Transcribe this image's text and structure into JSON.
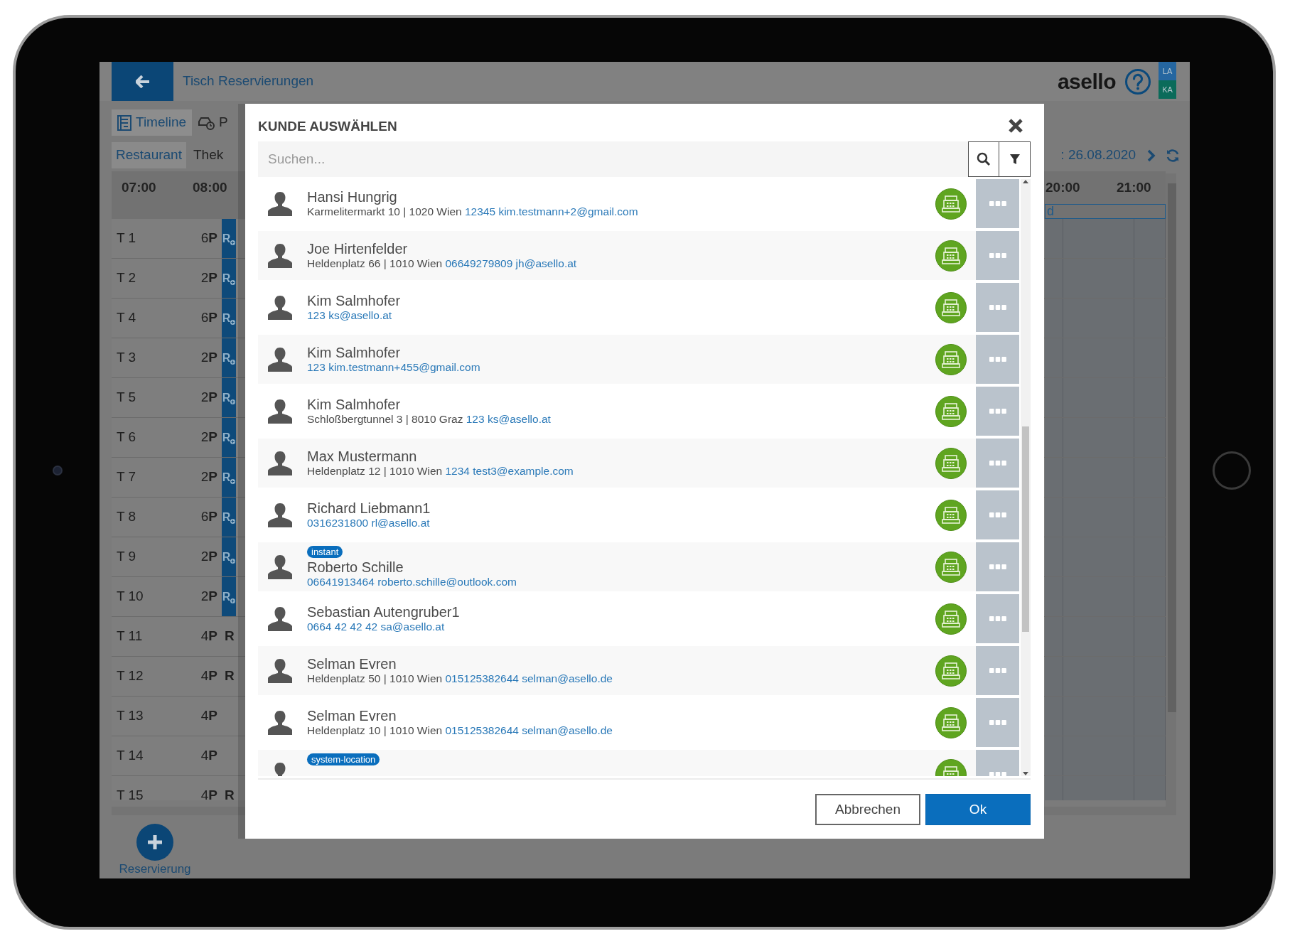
{
  "app": {
    "title": "Tisch Reservierungen",
    "brand": "asello",
    "users": [
      {
        "initials": "LA",
        "color": "#2566a0"
      },
      {
        "initials": "KA",
        "color": "#0b6b5a"
      }
    ]
  },
  "view_tabs": [
    {
      "label": "Timeline",
      "selected": true,
      "kind": "timeline"
    },
    {
      "label": "P",
      "selected": false,
      "kind": "car"
    }
  ],
  "areas": [
    {
      "label": "Restaurant",
      "selected": true
    },
    {
      "label": "Thek",
      "selected": false
    }
  ],
  "date": ": 26.08.2020",
  "time_columns": {
    "start": [
      "07:00",
      "08:00"
    ],
    "end": [
      "20:00",
      "21:00"
    ]
  },
  "reservation_bar": {
    "text": "d"
  },
  "tables": [
    {
      "name": "T 1",
      "seats": "6**P**",
      "marker": {
        "kind": "bar",
        "text": "R"
      }
    },
    {
      "name": "T 2",
      "seats": "2**P**",
      "marker": {
        "kind": "bar",
        "text": "R"
      }
    },
    {
      "name": "T 4",
      "seats": "6**P**",
      "marker": {
        "kind": "bar",
        "text": "R"
      }
    },
    {
      "name": "T 3",
      "seats": "2**P**",
      "marker": {
        "kind": "bar",
        "text": "R"
      }
    },
    {
      "name": "T 5",
      "seats": "2**P**",
      "marker": {
        "kind": "bar",
        "text": "R"
      }
    },
    {
      "name": "T 6",
      "seats": "2**P**",
      "marker": {
        "kind": "bar",
        "text": "R"
      }
    },
    {
      "name": "T 7",
      "seats": "2**P**",
      "marker": {
        "kind": "bar",
        "text": "R"
      }
    },
    {
      "name": "T 8",
      "seats": "6**P**",
      "marker": {
        "kind": "bar",
        "text": "R"
      }
    },
    {
      "name": "T 9",
      "seats": "2**P**",
      "marker": {
        "kind": "bar",
        "text": "R"
      }
    },
    {
      "name": "T 10",
      "seats": "2**P**",
      "marker": {
        "kind": "bar",
        "text": "R"
      }
    },
    {
      "name": "T 11",
      "seats": "4**P**",
      "marker": {
        "kind": "plain",
        "text": "R"
      }
    },
    {
      "name": "T 12",
      "seats": "4**P**",
      "marker": {
        "kind": "plain",
        "text": "R"
      }
    },
    {
      "name": "T 13",
      "seats": "4**P**"
    },
    {
      "name": "T 14",
      "seats": "4**P**"
    },
    {
      "name": "T 15",
      "seats": "4**P**",
      "marker": {
        "kind": "plain",
        "text": "R"
      }
    }
  ],
  "new_reservation": {
    "label": "Reservierung"
  },
  "dialog": {
    "title": "KUNDE AUSWÄHLEN",
    "search": {
      "placeholder": "Suchen..."
    },
    "customers": [
      {
        "name": "Hansi Hungrig",
        "address": "Karmelitermarkt 10 | 1020 Wien",
        "contact": "12345 kim.testmann+2@gmail.com"
      },
      {
        "name": "Joe Hirtenfelder",
        "address": "Heldenplatz 66 | 1010 Wien",
        "contact": "06649279809 jh@asello.at"
      },
      {
        "name": "Kim Salmhofer",
        "contact": "123 ks@asello.at"
      },
      {
        "name": "Kim Salmhofer",
        "contact": "123 kim.testmann+455@gmail.com"
      },
      {
        "name": "Kim Salmhofer",
        "address": "Schloßbergtunnel 3 | 8010 Graz",
        "contact": "123 ks@asello.at"
      },
      {
        "name": "Max Mustermann",
        "address": "Heldenplatz 12 | 1010 Wien",
        "contact": "1234 test3@example.com"
      },
      {
        "name": "Richard Liebmann1",
        "contact": "0316231800 rl@asello.at"
      },
      {
        "badge": "instant",
        "name": "Roberto Schille",
        "contact": "06641913464 roberto.schille@outlook.com"
      },
      {
        "name": "Sebastian Autengruber1",
        "contact": "0664 42 42 42 sa@asello.at"
      },
      {
        "name": "Selman Evren",
        "address": "Heldenplatz 50 | 1010 Wien",
        "contact": "015125382644 selman@asello.de"
      },
      {
        "name": "Selman Evren",
        "address": "Heldenplatz 10 | 1010 Wien",
        "contact": "015125382644 selman@asello.de"
      },
      {
        "badge": "system-location"
      }
    ],
    "buttons": [
      {
        "label": "Abbrechen",
        "kind": "secondary"
      },
      {
        "label": "Ok",
        "kind": "primary"
      }
    ]
  }
}
